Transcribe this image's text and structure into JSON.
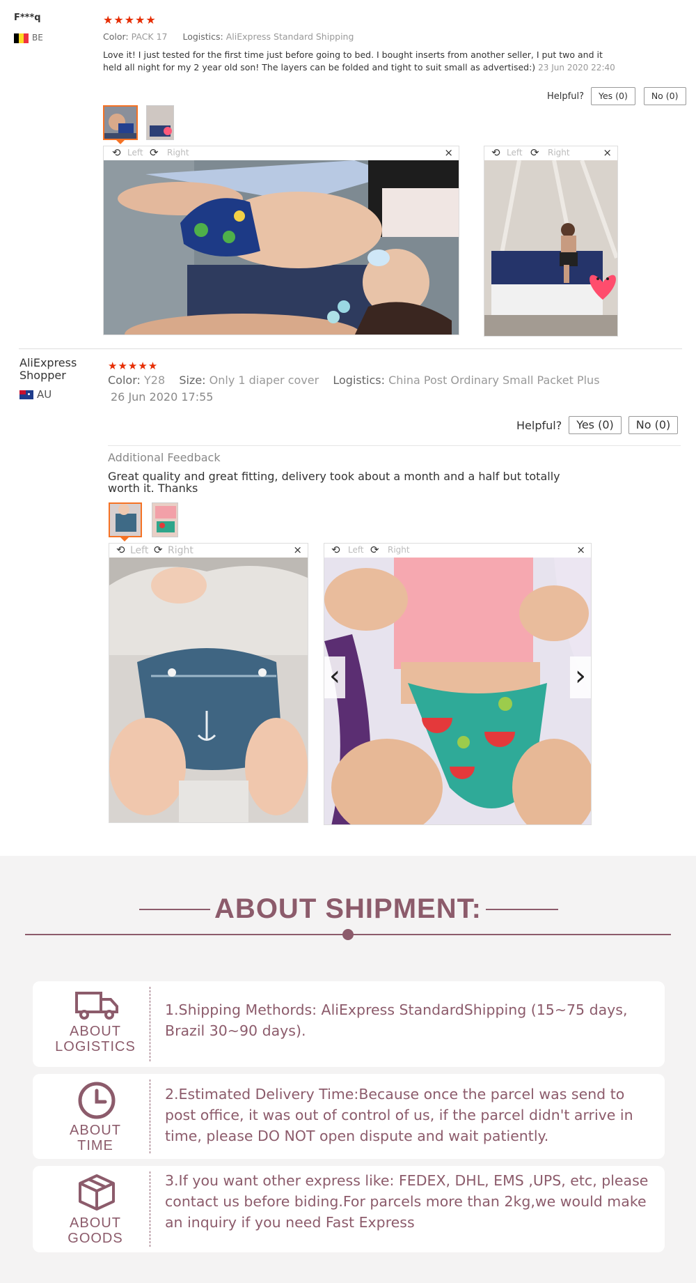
{
  "reviews": [
    {
      "user": "F***q",
      "country": "BE",
      "stars": "★★★★★",
      "color_label": "Color:",
      "color_value": "PACK 17",
      "logistics_label": "Logistics:",
      "logistics_value": "AliExpress Standard Shipping",
      "text": "Love it! I just tested for the first time just before going to bed. I bought inserts from another seller, I put two and it held all night for my 2 year old son! The layers can be folded and tight to suit small as advertised:)",
      "date": "23 Jun 2020 22:40",
      "helpful_label": "Helpful?",
      "yes_label": "Yes (0)",
      "no_label": "No (0)",
      "viewer": {
        "left": "Left",
        "right": "Right",
        "close": "×"
      }
    },
    {
      "user": "AliExpress Shopper",
      "country": "AU",
      "stars": "★★★★★",
      "color_label": "Color:",
      "color_value": "Y28",
      "size_label": "Size:",
      "size_value": "Only 1 diaper cover",
      "logistics_label": "Logistics:",
      "logistics_value": "China Post Ordinary Small Packet Plus",
      "date": "26 Jun 2020 17:55",
      "helpful_label": "Helpful?",
      "yes_label": "Yes (0)",
      "no_label": "No (0)",
      "additional_label": "Additional Feedback",
      "additional_text": "Great quality and great fitting, delivery took about a month and a half but totally worth it. Thanks",
      "viewer": {
        "left": "Left",
        "right": "Right",
        "close": "×",
        "prev": "‹",
        "next": "›"
      }
    }
  ],
  "shipment": {
    "title": "ABOUT SHIPMENT:",
    "cards": [
      {
        "icon": "truck-icon",
        "label_line1": "ABOUT",
        "label_line2": "LOGISTICS",
        "text": "1.Shipping Methords: AliExpress StandardShipping (15~75 days, Brazil 30~90 days)."
      },
      {
        "icon": "clock-icon",
        "label_line1": "ABOUT",
        "label_line2": "TIME",
        "text": "2.Estimated Delivery Time:Because once the parcel was send to post office, it was out of control of us, if the parcel didn't arrive in time, please DO NOT open dispute and wait patiently."
      },
      {
        "icon": "box-icon",
        "label_line1": "ABOUT",
        "label_line2": "GOODS",
        "text": "3.If you want other express like: FEDEX, DHL, EMS ,UPS, etc, please contact us before biding.For parcels more than 2kg,we would make an inquiry if you need Fast Express"
      }
    ]
  },
  "colors": {
    "star": "#e62e04",
    "accent": "#8c5b6b",
    "thumb_active": "#f57224",
    "shipment_bg": "#f4f3f3"
  }
}
